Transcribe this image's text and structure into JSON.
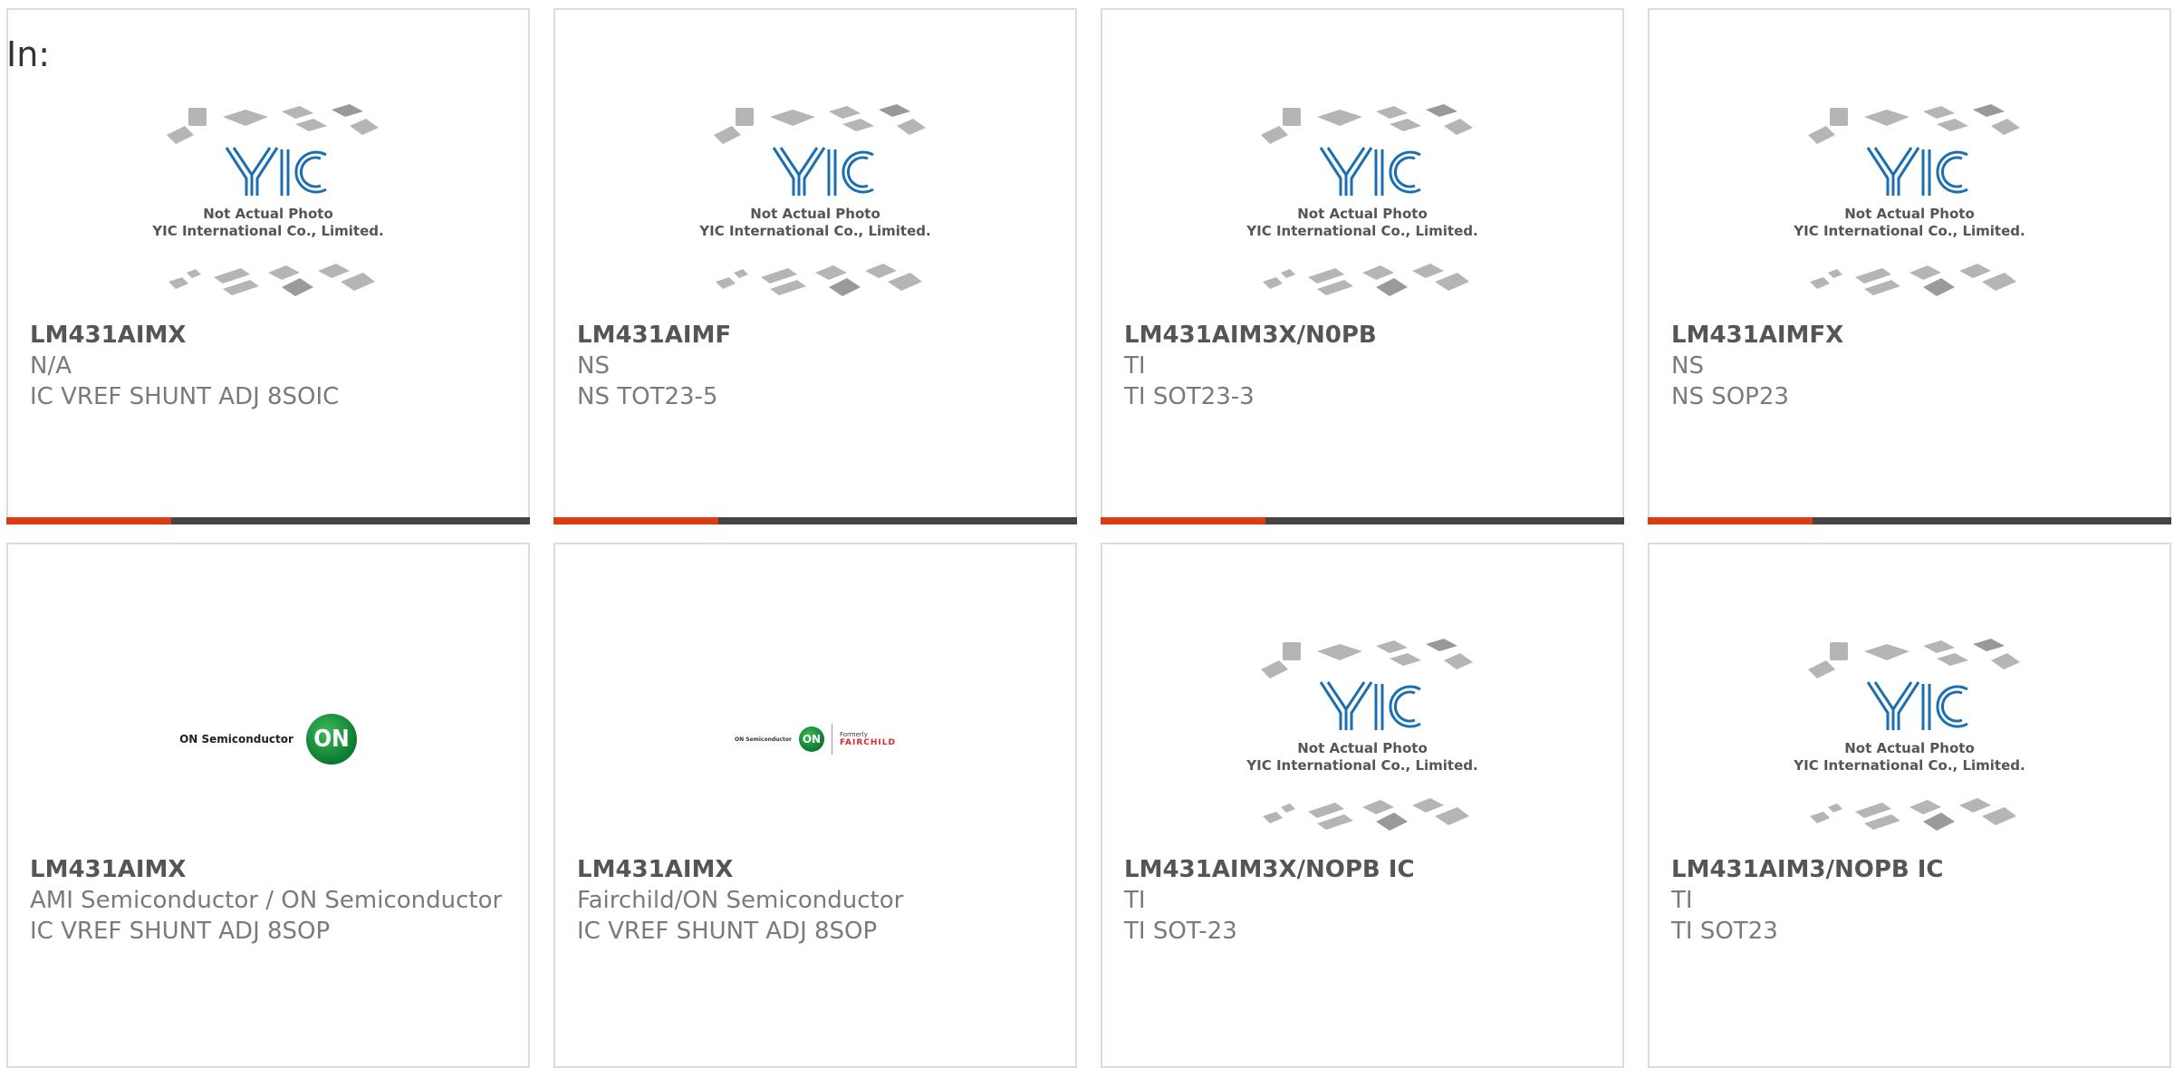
{
  "header": {
    "in_label": "In:"
  },
  "placeholder_image": {
    "brand": "YIC",
    "line1": "Not Actual Photo",
    "line2": "YIC International Co., Limited."
  },
  "on_logo": {
    "text": "ON Semiconductor",
    "mark": "ON"
  },
  "fairchild_logo": {
    "left_text": "ON Semiconductor",
    "mark": "ON",
    "formerly": "Formerly",
    "fairchild": "FAIRCHILD"
  },
  "colors": {
    "accent": "#e03a12",
    "bar": "#444444",
    "border": "#dcdcdc",
    "yic_blue": "#1a6fb0"
  },
  "products": [
    {
      "part": "LM431AIMX",
      "mfr": "N/A",
      "desc": "IC VREF SHUNT ADJ 8SOIC",
      "image": "placeholder"
    },
    {
      "part": "LM431AIMF",
      "mfr": "NS",
      "desc": "NS TOT23-5",
      "image": "placeholder"
    },
    {
      "part": "LM431AIM3X/N0PB",
      "mfr": "TI",
      "desc": "TI SOT23-3",
      "image": "placeholder"
    },
    {
      "part": "LM431AIMFX",
      "mfr": "NS",
      "desc": "NS SOP23",
      "image": "placeholder"
    },
    {
      "part": "LM431AIMX",
      "mfr": "AMI Semiconductor / ON Semiconductor",
      "desc": "IC VREF SHUNT ADJ 8SOP",
      "image": "on-logo"
    },
    {
      "part": "LM431AIMX",
      "mfr": "Fairchild/ON Semiconductor",
      "desc": "IC VREF SHUNT ADJ 8SOP",
      "image": "fairchild-logo"
    },
    {
      "part": "LM431AIM3X/NOPB IC",
      "mfr": "TI",
      "desc": "TI SOT-23",
      "image": "placeholder"
    },
    {
      "part": "LM431AIM3/NOPB IC",
      "mfr": "TI",
      "desc": "TI SOT23",
      "image": "placeholder"
    }
  ]
}
